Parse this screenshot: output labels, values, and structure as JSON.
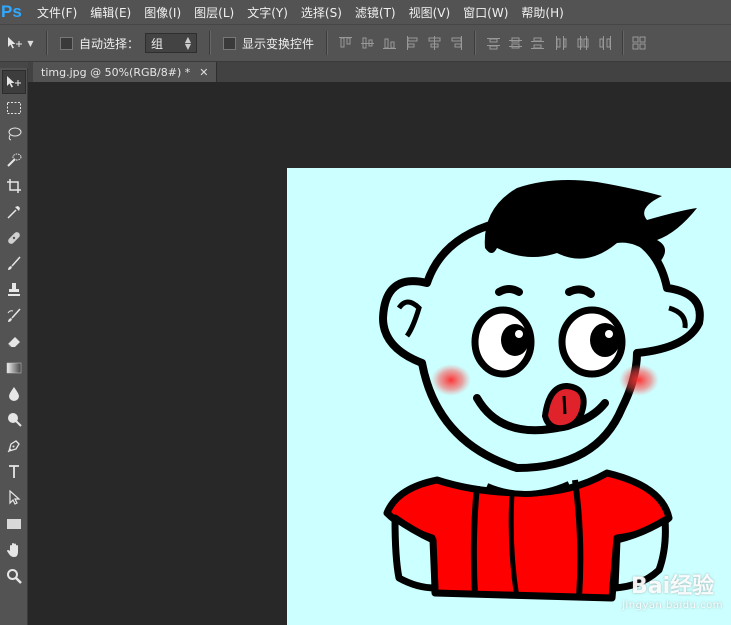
{
  "app": {
    "logo": "Ps"
  },
  "menubar": {
    "items": [
      {
        "label": "文件(F)"
      },
      {
        "label": "编辑(E)"
      },
      {
        "label": "图像(I)"
      },
      {
        "label": "图层(L)"
      },
      {
        "label": "文字(Y)"
      },
      {
        "label": "选择(S)"
      },
      {
        "label": "滤镜(T)"
      },
      {
        "label": "视图(V)"
      },
      {
        "label": "窗口(W)"
      },
      {
        "label": "帮助(H)"
      }
    ]
  },
  "options": {
    "auto_select_label": "自动选择：",
    "auto_select_checked": false,
    "auto_select_target": "组",
    "show_transform_label": "显示变换控件",
    "show_transform_checked": false
  },
  "document": {
    "tab_title": "timg.jpg @ 50%(RGB/8#) *",
    "zoom": "50%",
    "background_color": "#ccffff"
  },
  "watermark": {
    "text": "Bai经验",
    "sub": "jingyan.baidu.com"
  },
  "colors": {
    "ui_panel": "#535353",
    "workspace": "#282828",
    "ps_blue": "#31a8ff",
    "shirt": "#ff0000",
    "hair": "#000000"
  }
}
